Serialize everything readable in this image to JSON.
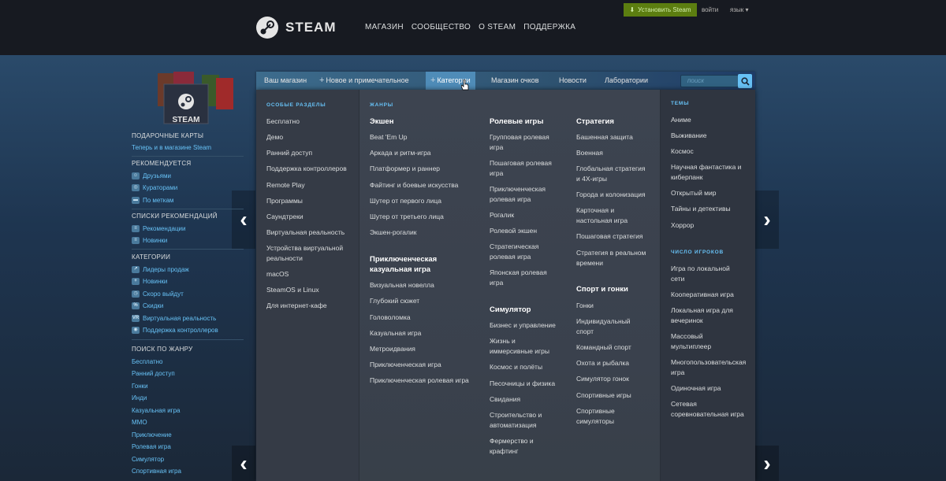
{
  "header": {
    "logo_text": "STEAM",
    "nav": [
      "МАГАЗИН",
      "СООБЩЕСТВО",
      "О STEAM",
      "ПОДДЕРЖКА"
    ],
    "install_label": "Установить Steam",
    "login_label": "войти",
    "language_label": "язык ▾"
  },
  "sidebar": {
    "giftcards_label": "STEAM",
    "giftcards_title": "ПОДАРОЧНЫЕ КАРТЫ",
    "giftcards_link": "Теперь и в магазине Steam",
    "recommended_title": "РЕКОМЕНДУЕТСЯ",
    "recommended": [
      "Друзьями",
      "Кураторами",
      "По меткам"
    ],
    "lists_title": "СПИСКИ РЕКОМЕНДАЦИЙ",
    "lists": [
      "Рекомендации",
      "Новинки"
    ],
    "categories_title": "КАТЕГОРИИ",
    "categories": [
      "Лидеры продаж",
      "Новинки",
      "Скоро выйдут",
      "Скидки",
      "Виртуальная реальность",
      "Поддержка контроллеров"
    ],
    "genre_title": "ПОИСК ПО ЖАНРУ",
    "genres": [
      "Бесплатно",
      "Ранний доступ",
      "Гонки",
      "Инди",
      "Казуальная игра",
      "MMO",
      "Приключение",
      "Ролевая игра",
      "Симулятор",
      "Спортивная игра"
    ]
  },
  "storenav": {
    "items": [
      "Ваш магазин",
      "Новое и примечательное",
      "Категории",
      "Магазин очков",
      "Новости",
      "Лаборатории"
    ],
    "search_placeholder": "поиск"
  },
  "dropdown": {
    "special_title": "ОСОБЫЕ РАЗДЕЛЫ",
    "special": [
      "Бесплатно",
      "Демо",
      "Ранний доступ",
      "Поддержка контроллеров",
      "Remote Play",
      "Программы",
      "Саундтреки",
      "Виртуальная реальность",
      "Устройства виртуальной",
      "реальности",
      "macOS",
      "SteamOS и Linux",
      "Для интернет-кафе"
    ],
    "genres_title": "ЖАНРЫ",
    "action_title": "Экшен",
    "action": [
      "Beat 'Em Up",
      "Аркада и ритм-игра",
      "Платформер и раннер",
      "Файтинг и боевые искусства",
      "Шутер от первого лица",
      "Шутер от третьего лица",
      "Экшен-рогалик"
    ],
    "adventure_title_1": "Приключенческая",
    "adventure_title_2": "казуальная игра",
    "adventure": [
      "Визуальная новелла",
      "Глубокий сюжет",
      "Головоломка",
      "Казуальная игра",
      "Метроидвания",
      "Приключенческая игра",
      "Приключенческая ролевая игра"
    ],
    "rpg_title": "Ролевые игры",
    "rpg": [
      "Групповая ролевая",
      "игра",
      "Пошаговая ролевая",
      "игра",
      "Приключенческая",
      "ролевая игра",
      "Рогалик",
      "Ролевой экшен",
      "Стратегическая",
      "ролевая игра",
      "Японская ролевая",
      "игра"
    ],
    "sim_title": "Симулятор",
    "sim": [
      "Бизнес и управление",
      "Жизнь и",
      "иммерсивные игры",
      "Космос и полёты",
      "Песочницы и физика",
      "Свидания",
      "Строительство и",
      "автоматизация",
      "Фермерство и",
      "крафтинг"
    ],
    "strategy_title": "Стратегия",
    "strategy": [
      "Башенная защита",
      "Военная",
      "Глобальная стратегия",
      "и 4X-игры",
      "Города и колонизация",
      "Карточная и",
      "настольная игра",
      "Пошаговая стратегия",
      "Стратегия в реальном",
      "времени"
    ],
    "sports_title": "Спорт и гонки",
    "sports": [
      "Гонки",
      "Индивидуальный",
      "спорт",
      "Командный спорт",
      "Охота и рыбалка",
      "Симулятор гонок",
      "Спортивные игры",
      "Спортивные",
      "симуляторы"
    ],
    "themes_title": "ТЕМЫ",
    "themes": [
      "Аниме",
      "Выживание",
      "Космос",
      "Научная фантастика и",
      "киберпанк",
      "Открытый мир",
      "Тайны и детективы",
      "Хоррор"
    ],
    "players_title": "ЧИСЛО ИГРОКОВ",
    "players": [
      "Игра по локальной",
      "сети",
      "Кооперативная игра",
      "Локальная игра для",
      "вечеринок",
      "Массовый",
      "мультиплеер",
      "Многопользовательская",
      "игра",
      "Одиночная игра",
      "Сетевая",
      "соревновательная игра"
    ]
  },
  "colors": {
    "header_bg": "#171a21",
    "install_green": "#5c7e10",
    "link_blue": "#67c1f5",
    "panel_bg": "#3d4450"
  }
}
